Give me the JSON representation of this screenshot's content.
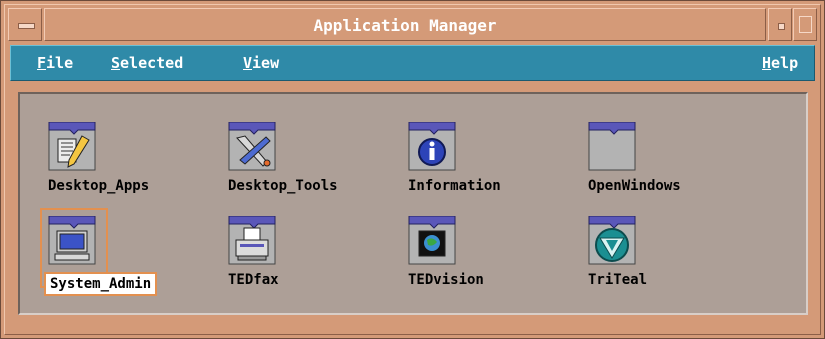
{
  "window": {
    "title": "Application Manager"
  },
  "menubar": {
    "file": "File",
    "file_rest": "ile",
    "file_mn": "F",
    "selected": "elected",
    "selected_mn": "S",
    "view": "iew",
    "view_mn": "V",
    "help": "elp",
    "help_mn": "H"
  },
  "groups": [
    {
      "label": "Desktop_Apps",
      "icon": "desktop-apps-icon"
    },
    {
      "label": "Desktop_Tools",
      "icon": "desktop-tools-icon"
    },
    {
      "label": "Information",
      "icon": "information-icon"
    },
    {
      "label": "OpenWindows",
      "icon": "openwindows-icon"
    },
    {
      "label": "System_Admin",
      "icon": "system-admin-icon"
    },
    {
      "label": "TEDfax",
      "icon": "tedfax-icon"
    },
    {
      "label": "TEDvision",
      "icon": "tedvision-icon"
    },
    {
      "label": "TriTeal",
      "icon": "triteal-icon"
    }
  ],
  "selected_group": "System_Admin",
  "colors": {
    "frame": "#d49a78",
    "menubar": "#2f8aa8",
    "workspace": "#ad9f97",
    "selection": "#e3904f"
  }
}
